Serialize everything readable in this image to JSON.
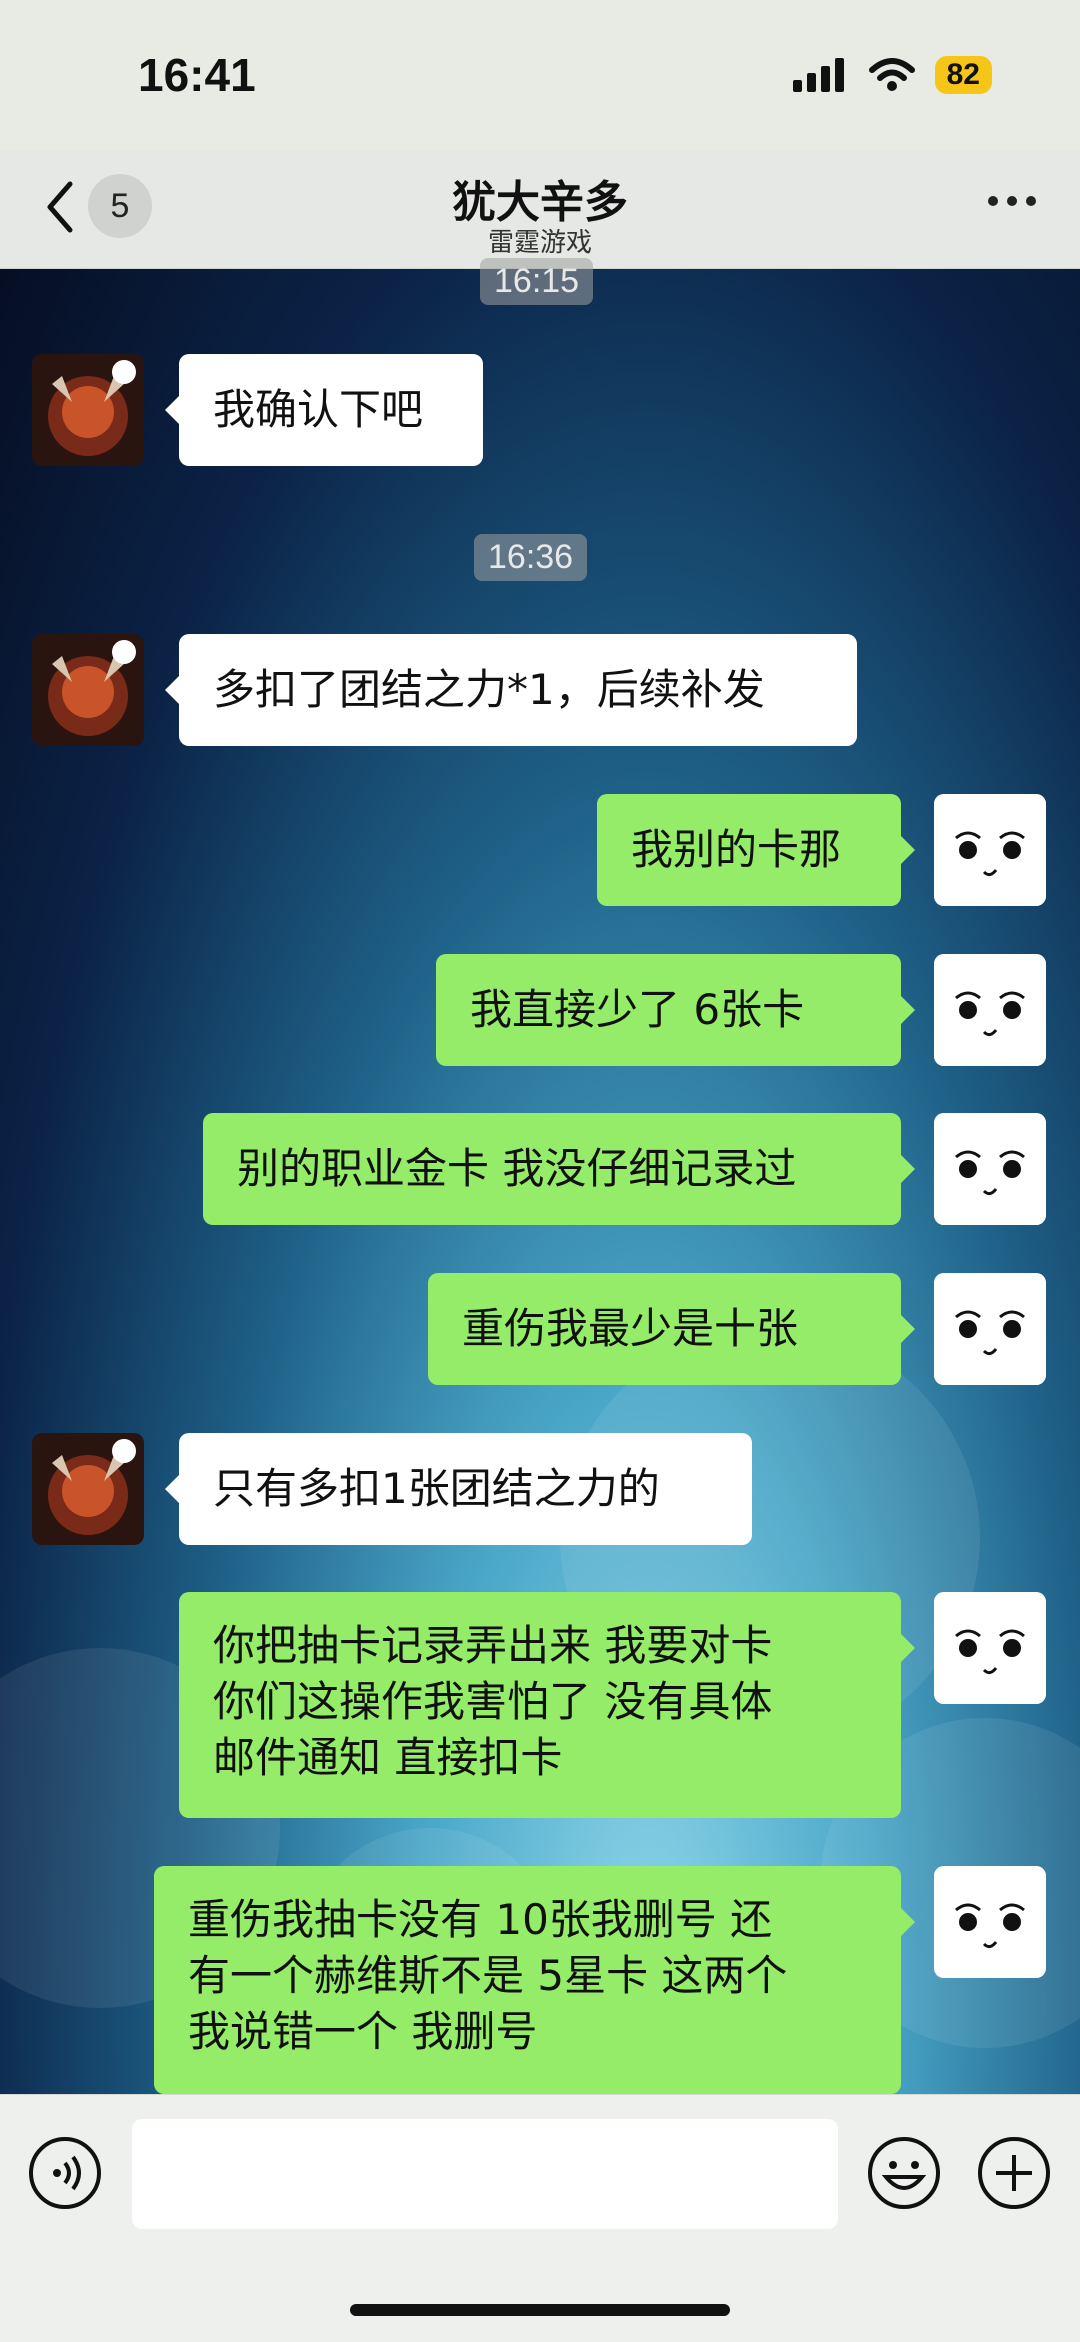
{
  "status_bar": {
    "time": "16:41",
    "battery": "82"
  },
  "nav": {
    "unread_count": "5",
    "title": "犹大辛多",
    "subtitle": "雷霆游戏"
  },
  "messages": {
    "ts1": "16:15",
    "m1": "我确认下吧",
    "ts2": "16:36",
    "m2": "多扣了团结之力*1，后续补发",
    "m3": "我别的卡那",
    "m4": "我直接少了 6张卡",
    "m5": "别的职业金卡 我没仔细记录过",
    "m6": "重伤我最少是十张",
    "m7": "只有多扣1张团结之力的",
    "m8_l1": "你把抽卡记录弄出来 我要对卡",
    "m8_l2": "你们这操作我害怕了  没有具体",
    "m8_l3": "邮件通知   直接扣卡",
    "m9_l1": "重伤我抽卡没有 10张我删号    还",
    "m9_l2": "有一个赫维斯不是 5星卡 这两个",
    "m9_l3": "我说错一个 我删号"
  },
  "input": {
    "placeholder": ""
  },
  "colors": {
    "sent_bubble": "#95ec69",
    "received_bubble": "#ffffff",
    "battery": "#f5c518"
  }
}
